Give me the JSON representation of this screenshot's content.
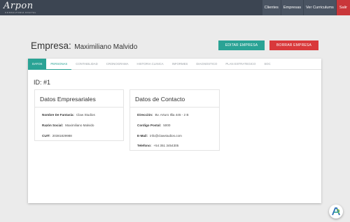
{
  "brand": {
    "name": "Arpon",
    "tagline": "CONSULTORIA DIGITAL"
  },
  "nav": {
    "items": [
      "Clientes",
      "Empresas",
      "Ver Curriculums"
    ],
    "exit_label": "Salir"
  },
  "header": {
    "title_label": "Empresa:",
    "title_value": "Maximiliano Malvido"
  },
  "actions": {
    "edit_label": "EDITAR EMPRESA",
    "delete_label": "BORRAR EMPRESA"
  },
  "tabs": [
    "DATOS",
    "PERSONAS",
    "CONTABILIDAD",
    "CRONOGRAMA",
    "HISTORIA CLINICA",
    "INFORMES",
    "DIAGNOSTICO",
    "PLAN ESTRATEGICO",
    "SOC"
  ],
  "record": {
    "id_label": "ID: #1"
  },
  "empresariales": {
    "title": "Datos Empresariales",
    "rows": [
      {
        "key": "Nombre De Fantasía:",
        "value": "Claw Studios"
      },
      {
        "key": "Razón Social:",
        "value": "Maximiliano Malvido"
      },
      {
        "key": "CUIT:",
        "value": "20381829988"
      }
    ]
  },
  "contacto": {
    "title": "Datos de Contacto",
    "rows": [
      {
        "key": "Dirección:",
        "value": "Bv. Arturo Illia 445 - 2 B"
      },
      {
        "key": "Cordigo Postal:",
        "value": "5000"
      },
      {
        "key": "E-Mail:",
        "value": "info@clawstudios.com"
      },
      {
        "key": "Telefono:",
        "value": "+54 351 3454305"
      }
    ]
  },
  "colors": {
    "topbar": "#3c4552",
    "accent": "#2aa395",
    "danger": "#d9393b",
    "background": "#ebebeb"
  }
}
